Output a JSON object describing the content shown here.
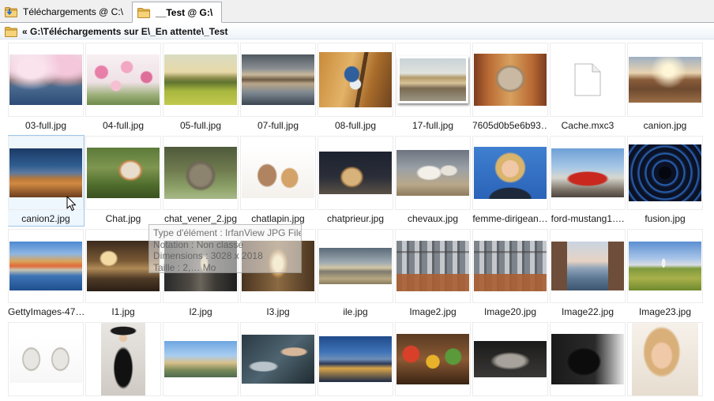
{
  "colors": {
    "selection_bg": "#eef6fe",
    "selection_border": "#9ec6ec"
  },
  "tabs": [
    {
      "label": "Téléchargements @ C:\\",
      "icon": "folder-download-icon",
      "active": false
    },
    {
      "label": "__Test @ G:\\",
      "icon": "folder-icon",
      "active": true
    }
  ],
  "address": {
    "icon": "folder-icon",
    "path": "« G:\\Téléchargements sur E\\_En attente\\_Test"
  },
  "grid": {
    "items": [
      {
        "label": "03-full.jpg",
        "thumbnail": "cherry-blossom-lake"
      },
      {
        "label": "04-full.jpg",
        "thumbnail": "pink-flowers"
      },
      {
        "label": "05-full.jpg",
        "thumbnail": "green-field-sunset"
      },
      {
        "label": "07-full.jpg",
        "thumbnail": "mountain-lake-reflection"
      },
      {
        "label": "08-full.jpg",
        "thumbnail": "blue-jay-branch"
      },
      {
        "label": "17-full.jpg",
        "thumbnail": "framed-train"
      },
      {
        "label": "7605d0b5e6b93…",
        "thumbnail": "cat-window"
      },
      {
        "label": "Cache.mxc3",
        "thumbnail": "generic-file-icon"
      },
      {
        "label": "canion.jpg",
        "thumbnail": "canyon-sunset"
      },
      {
        "label": "canion2.jpg",
        "thumbnail": "canyon-dusk",
        "selected": true
      },
      {
        "label": "Chat.jpg",
        "thumbnail": "cat-grass"
      },
      {
        "label": "chat_vener_2.jpg",
        "thumbnail": "tabby-cat-face"
      },
      {
        "label": "chatlapin.jpg",
        "thumbnail": "rabbit-kitten"
      },
      {
        "label": "chatprieur.jpg",
        "thumbnail": "kitten-dark"
      },
      {
        "label": "chevaux.jpg",
        "thumbnail": "white-horses"
      },
      {
        "label": "femme-dirigean…",
        "thumbnail": "woman-portrait-blue"
      },
      {
        "label": "ford-mustang1….",
        "thumbnail": "red-mustang"
      },
      {
        "label": "fusion.jpg",
        "thumbnail": "blue-tunnel"
      },
      {
        "label": "GettyImages-47…",
        "thumbnail": "coastal-town"
      },
      {
        "label": "I1.jpg",
        "thumbnail": "luxury-interior"
      },
      {
        "label": "I2.jpg",
        "thumbnail": "dark-hallway"
      },
      {
        "label": "I3.jpg",
        "thumbnail": "lit-corridor"
      },
      {
        "label": "ile.jpg",
        "thumbnail": "beach-island"
      },
      {
        "label": "Image2.jpg",
        "thumbnail": "steel-corridor"
      },
      {
        "label": "Image20.jpg",
        "thumbnail": "steel-corridor"
      },
      {
        "label": "Image22.jpg",
        "thumbnail": "canal-evening"
      },
      {
        "label": "Image23.jpg",
        "thumbnail": "field-lighthouse"
      },
      {
        "thumbnail": "statue-busts"
      },
      {
        "thumbnail": "woman-black-hat"
      },
      {
        "thumbnail": "mountain-peak"
      },
      {
        "thumbnail": "robot-hand"
      },
      {
        "thumbnail": "city-night"
      },
      {
        "thumbnail": "market-stall"
      },
      {
        "thumbnail": "grey-cat-lying"
      },
      {
        "thumbnail": "black-cat"
      },
      {
        "thumbnail": "smiling-woman"
      }
    ]
  },
  "tooltip": {
    "lines": [
      "Type d'élément : IrfanView JPG File",
      "Notation : Non classé",
      "Dimensions : 3028 x 2018",
      "Taille : 2,… Mo"
    ]
  }
}
